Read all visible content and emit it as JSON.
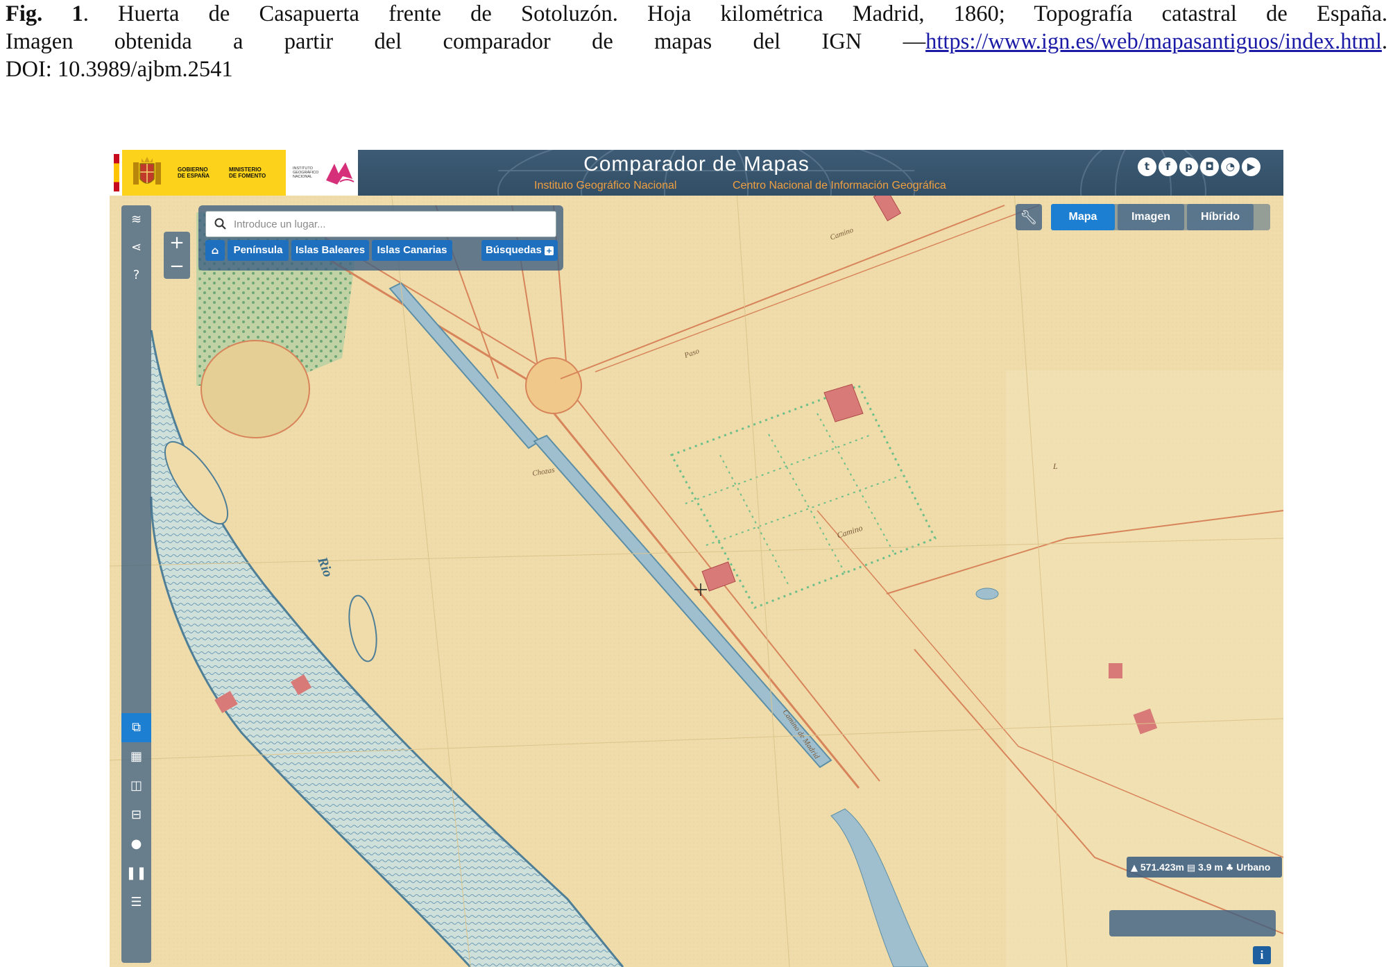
{
  "caption": {
    "fig_label": "Fig. 1",
    "line1_rest": ". Huerta de Casapuerta frente de Sotoluzón. Hoja kilométrica Madrid, 1860; Topografía catastral de España.",
    "line2_text": "Imagen obtenida a partir del comparador de mapas del IGN —",
    "line2_link": "https://www.ign.es/web/mapasantiguos/index.html",
    "line2_end": ".",
    "line3": "DOI: 10.3989/ajbm.2541"
  },
  "header": {
    "title": "Comparador de Mapas",
    "sub_left": "Instituto Geográfico Nacional",
    "sub_right": "Centro Nacional de Información Geográfica",
    "gov_line1": "GOBIERNO",
    "gov_line2": "DE ESPAÑA",
    "min_line1": "MINISTERIO",
    "min_line2": "DE FOMENTO",
    "ign_line1": "INSTITUTO",
    "ign_line2": "GEOGRÁFICO",
    "ign_line3": "NACIONAL",
    "social_icons": [
      "twitter-icon",
      "facebook-icon",
      "pinterest-icon",
      "instagram-icon",
      "rss-icon",
      "youtube-icon"
    ]
  },
  "search": {
    "placeholder": "Introduce un lugar...",
    "quick": [
      "Península",
      "Islas Baleares",
      "Islas Canarias"
    ],
    "searches": "Búsquedas"
  },
  "maptype": {
    "options": [
      "Mapa",
      "Imagen",
      "Híbrido"
    ],
    "selected": "Mapa"
  },
  "status": {
    "altitude": "571.423m",
    "resolution": "3.9 m",
    "landuse": "Urbano"
  },
  "map_labels": {
    "river_label": "Rio",
    "plot_letter": "L",
    "camino": "Camino",
    "camino2": "Camino",
    "paso": "Paso",
    "chozas": "Chozas",
    "camino_diag": "Camino de Madrid"
  },
  "colors": {
    "header": "#324e66",
    "accent": "#1d7fd1",
    "subtitle": "#f0a040",
    "map_paper": "#efdcaa",
    "river": "#6f9fb7"
  }
}
